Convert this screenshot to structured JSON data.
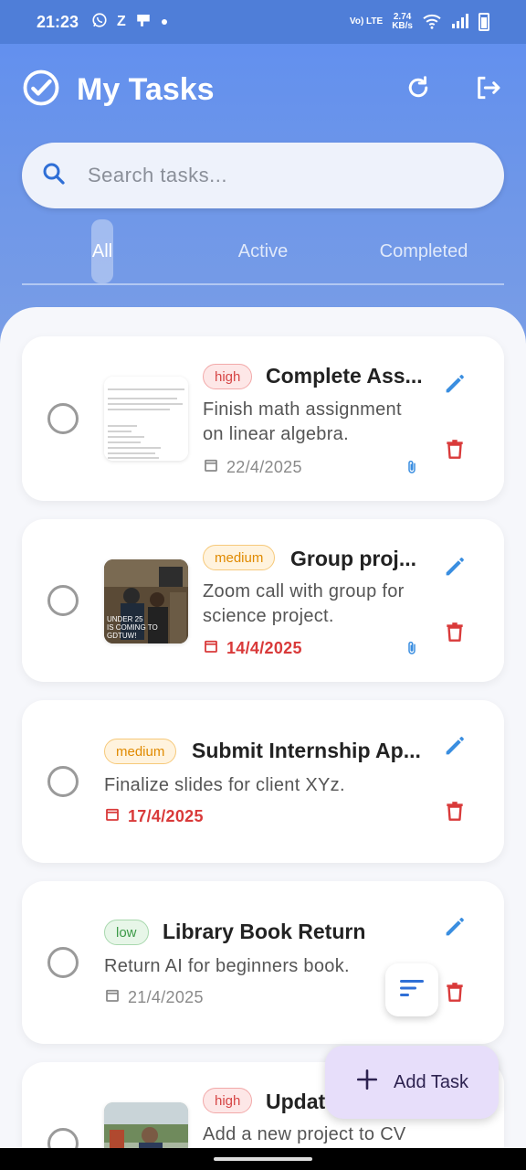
{
  "status_bar": {
    "time": "21:23",
    "left_icons": [
      "whatsapp-icon",
      "z-icon",
      "app-icon",
      "dot"
    ],
    "network_label": "Vo) LTE",
    "speed_value": "2.74",
    "speed_unit": "KB/s"
  },
  "app": {
    "title": "My Tasks"
  },
  "search": {
    "placeholder": "Search tasks..."
  },
  "tabs": [
    {
      "label": "All",
      "selected": true
    },
    {
      "label": "Active",
      "selected": false
    },
    {
      "label": "Completed",
      "selected": false
    }
  ],
  "tasks": [
    {
      "priority": "high",
      "title": "Complete Ass...",
      "description_line1": "Finish math assignment",
      "description_line2": "on linear algebra.",
      "date": "22/4/2025",
      "overdue": false,
      "has_attachment": true,
      "thumbnail": "document"
    },
    {
      "priority": "medium",
      "title": "Group proj...",
      "description_line1": "Zoom call with group for",
      "description_line2": "science project.",
      "date": "14/4/2025",
      "overdue": true,
      "has_attachment": true,
      "thumbnail": "photo",
      "thumbnail_caption_1": "UNDER 25",
      "thumbnail_caption_2": "IS COMING TO",
      "thumbnail_caption_3": "GDTUW!"
    },
    {
      "priority": "medium",
      "title": "Submit Internship Ap...",
      "description": "Finalize slides for client XYz.",
      "date": "17/4/2025",
      "overdue": true,
      "has_attachment": false
    },
    {
      "priority": "low",
      "title": "Library Book Return",
      "description": "Return AI for beginners book.",
      "date": "21/4/2025",
      "overdue": false,
      "has_attachment": false
    },
    {
      "priority": "high",
      "title": "Updat",
      "description": "Add a new project to CV",
      "has_attachment": false,
      "thumbnail": "photo"
    }
  ],
  "fab": {
    "add_label": "Add Task"
  },
  "colors": {
    "header": "#6f97e8",
    "high": "#d64545",
    "medium": "#e08a00",
    "low": "#3c9a48",
    "edit": "#3a8ee0",
    "delete": "#d93a3a"
  }
}
